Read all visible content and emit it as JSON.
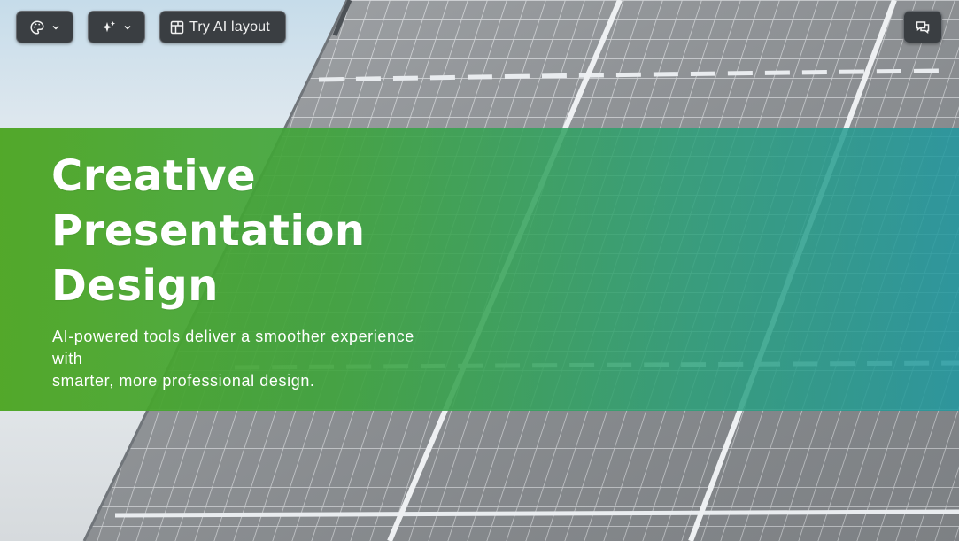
{
  "toolbar": {
    "theme_icon": "palette-icon",
    "ai_icon": "sparkle-icon",
    "layout_icon": "layout-icon",
    "layout_label": "Try AI layout",
    "comment_icon": "comment-icon",
    "chevron_icon": "chevron-down-icon"
  },
  "slide": {
    "title_line1": "Creative",
    "title_line2": "Presentation",
    "title_line3": "Design",
    "subtitle_line1": "AI-powered tools deliver a smoother experience",
    "subtitle_line2": "with",
    "subtitle_line3": "smarter, more professional design."
  },
  "colors": {
    "banner_start": "#4ea624",
    "banner_end": "#2098a0",
    "toolbar_bg": "#3a3e42"
  }
}
